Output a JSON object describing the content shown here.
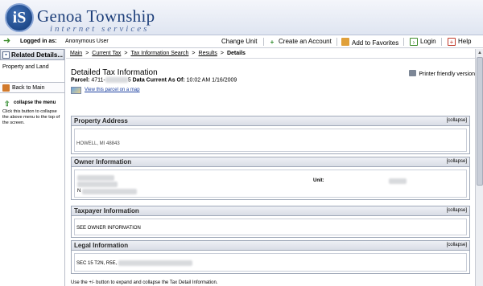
{
  "brand": {
    "logo_text": "iS",
    "name": "Genoa Township",
    "subtitle": "internet services"
  },
  "toolbar": {
    "logged_label": "Logged in as:",
    "logged_user": "Anonymous User",
    "change_unit": "Change Unit",
    "create_account": "Create an Account",
    "add_favorites": "Add to Favorites",
    "login": "Login",
    "help": "Help"
  },
  "sidebar": {
    "related_label": "Related Details...",
    "property_land": "Property and Land",
    "back_main": "Back to Main",
    "collapse_label": "collapse the menu",
    "collapse_help": "Click this button to collapse the above menu to the top of the screen."
  },
  "breadcrumb": {
    "items": [
      "Main",
      "Current Tax",
      "Tax Information Search",
      "Results"
    ],
    "current": "Details",
    "sep": ">"
  },
  "main": {
    "title": "Detailed Tax Information",
    "parcel_label": "Parcel:",
    "parcel_value_visible": "4711-",
    "parcel_value_suffix": "5",
    "data_current_label": "Data Current As Of:",
    "data_current_time": "10:02 AM",
    "data_current_date": "1/16/2009",
    "map_link": "View this parcel on a map",
    "printer_link": "Printer friendly version"
  },
  "panels": {
    "collapse_text": "[collapse]",
    "property_address": {
      "title": "Property Address",
      "line": "HOWELL, MI 48843"
    },
    "owner": {
      "title": "Owner Information",
      "unit_label": "Unit:",
      "partial": "N"
    },
    "taxpayer": {
      "title": "Taxpayer Information",
      "line": "SEE OWNER INFORMATION"
    },
    "legal": {
      "title": "Legal Information",
      "line": "SEC 15 T2N, R5E, "
    }
  },
  "bottom_note": "Use the +/- button to expand and collapse the Tax Detail Information.",
  "colors": {
    "link": "#1a3fa0",
    "brand": "#1d3f7a"
  }
}
